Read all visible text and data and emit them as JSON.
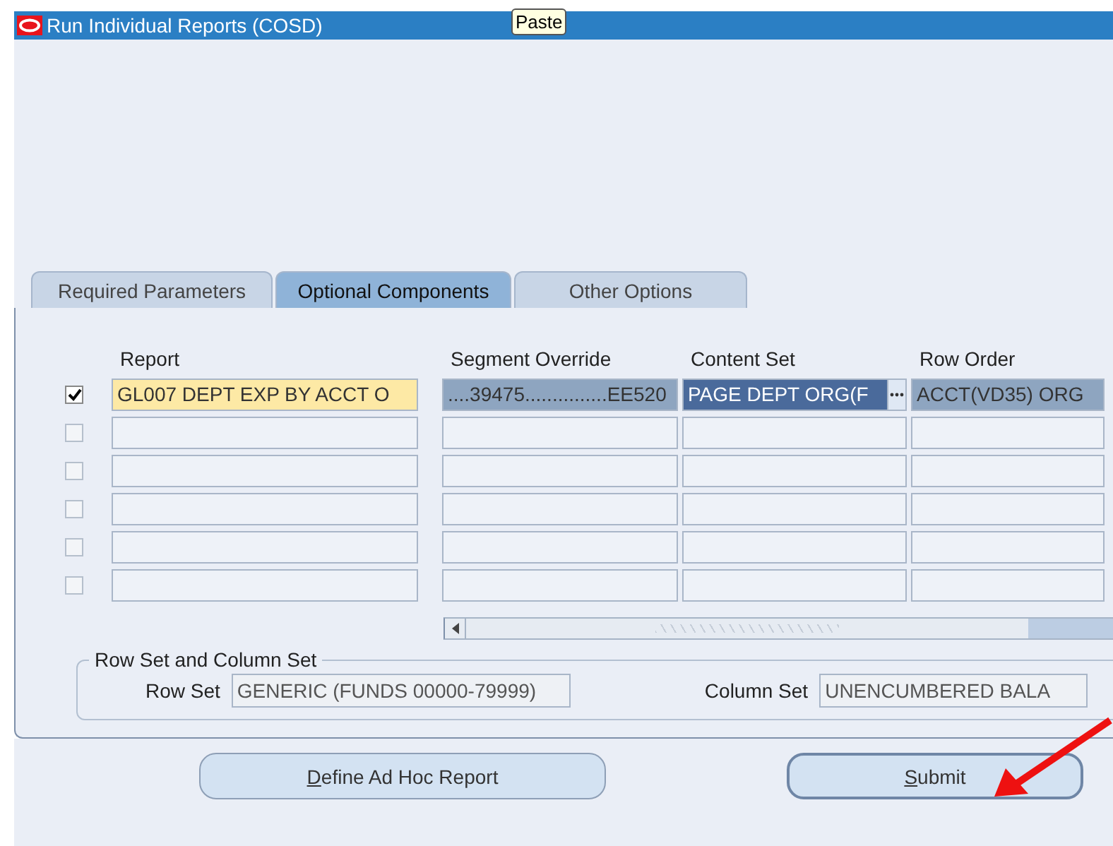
{
  "window": {
    "title": "Run Individual Reports (COSD)"
  },
  "tooltip": "Paste",
  "tabs": [
    {
      "label": "Required Parameters",
      "selected": false
    },
    {
      "label": "Optional Components",
      "selected": true
    },
    {
      "label": "Other Options",
      "selected": false
    }
  ],
  "table": {
    "columns": [
      "Report",
      "Segment Override",
      "Content Set",
      "Row Order"
    ],
    "rows": [
      {
        "checked": true,
        "cells": [
          {
            "text": "GL007 DEPT EXP BY ACCT O",
            "focused": true,
            "highlighted": false
          },
          {
            "text": "....39475...............EE520",
            "focused": false,
            "highlighted": false
          },
          {
            "text": "PAGE DEPT ORG(F",
            "focused": false,
            "highlighted": true
          },
          {
            "text": "ACCT(VD35) ORG",
            "focused": false,
            "highlighted": false
          }
        ]
      },
      {
        "checked": false
      },
      {
        "checked": false
      },
      {
        "checked": false
      },
      {
        "checked": false
      },
      {
        "checked": false
      }
    ]
  },
  "row_column_set": {
    "title": "Row Set and Column Set",
    "row_set_label": "Row Set",
    "row_set": "GENERIC (FUNDS 00000-79999)",
    "column_set_label": "Column Set",
    "column_set": "UNENCUMBERED BALA"
  },
  "buttons": [
    "Define Ad Hoc Report",
    "Submit"
  ]
}
